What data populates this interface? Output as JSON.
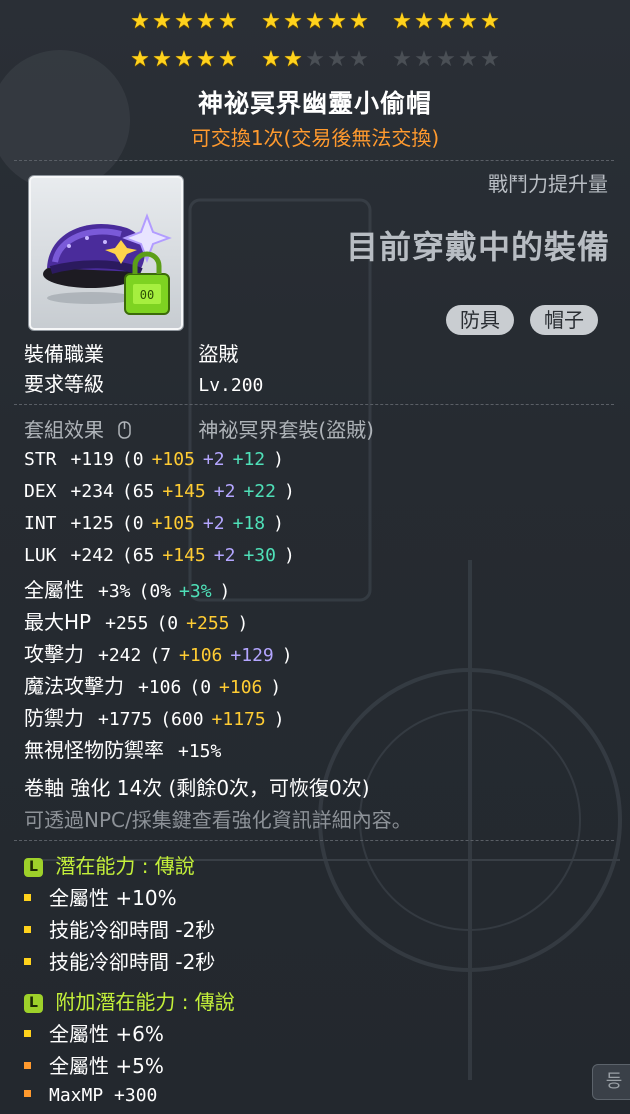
{
  "stars": {
    "total": 30,
    "filled": 22
  },
  "item": {
    "name": "神祕冥界幽靈小偷帽",
    "trade_note": "可交換1次(交易後無法交換)"
  },
  "header": {
    "power_label": "戰鬥力提升量",
    "equipped_label": "目前穿戴中的裝備",
    "tags": [
      "防具",
      "帽子"
    ]
  },
  "requirements": {
    "job_key": "裝備職業",
    "job_value": "盜賊",
    "level_key": "要求等級",
    "level_value": "Lv.200"
  },
  "set_effect": {
    "key": "套組效果",
    "value": "神祕冥界套裝(盜賊)"
  },
  "stats": [
    {
      "key": "STR",
      "total": "+119",
      "base": "(0",
      "bonus": "+105",
      "enhance": "+2",
      "star": "+12",
      "close": ")"
    },
    {
      "key": "DEX",
      "total": "+234",
      "base": "(65",
      "bonus": "+145",
      "enhance": "+2",
      "star": "+22",
      "close": ")"
    },
    {
      "key": "INT",
      "total": "+125",
      "base": "(0",
      "bonus": "+105",
      "enhance": "+2",
      "star": "+18",
      "close": ")"
    },
    {
      "key": "LUK",
      "total": "+242",
      "base": "(65",
      "bonus": "+145",
      "enhance": "+2",
      "star": "+30",
      "close": ")"
    },
    {
      "key": "全屬性",
      "total": "+3%",
      "base": "(0%",
      "bonus": "",
      "enhance": "",
      "star": "+3%",
      "close": ")"
    },
    {
      "key": "最大HP",
      "total": "+255",
      "base": "(0",
      "bonus": "+255",
      "enhance": "",
      "star": "",
      "close": ")"
    },
    {
      "key": "攻擊力",
      "total": "+242",
      "base": "(7",
      "bonus": "+106",
      "enhance": "+129",
      "star": "",
      "close": ")"
    },
    {
      "key": "魔法攻擊力",
      "total": "+106",
      "base": "(0",
      "bonus": "+106",
      "enhance": "",
      "star": "",
      "close": ")"
    },
    {
      "key": "防禦力",
      "total": "+1775",
      "base": "(600",
      "bonus": "+1175",
      "enhance": "",
      "star": "",
      "close": ")"
    },
    {
      "key": "無視怪物防禦率",
      "total": "+15%",
      "base": "",
      "bonus": "",
      "enhance": "",
      "star": "",
      "close": ""
    }
  ],
  "scroll": {
    "line": "卷軸 強化 14次 (剩餘0次，可恢復0次)",
    "hint": "可透過NPC/採集鍵查看強化資訊詳細內容。"
  },
  "potential": {
    "title": "潛在能力 : 傳說",
    "badge": "L",
    "lines": [
      "全屬性 +10%",
      "技能冷卻時間 -2秒",
      "技能冷卻時間 -2秒"
    ]
  },
  "additional_potential": {
    "title": "附加潛在能力 : 傳說",
    "badge": "L",
    "lines": [
      "全屬性 +6%",
      "全屬性 +5%",
      "MaxMP +300"
    ]
  },
  "corner_chip": "등",
  "colors": {
    "star_on": "#ffd21c",
    "trade_note": "#ff9a2e",
    "bonus_yellow": "#ffcc33",
    "enhance_purple": "#b4a6ff",
    "star_teal": "#4fe0b8",
    "potential_green": "#c4f03a",
    "legendary_badge": "#9ed12a"
  }
}
